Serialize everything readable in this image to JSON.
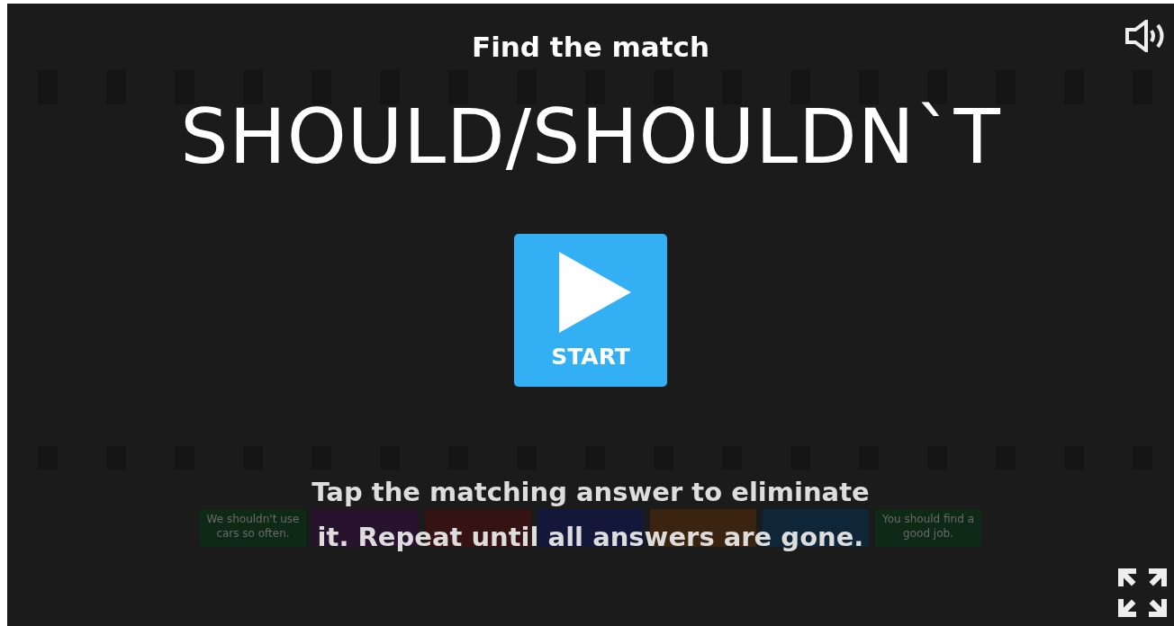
{
  "activity_type": "Find the match",
  "title": "SHOULD/SHOULDN`T",
  "start_button": {
    "label": "START"
  },
  "answer_tiles": [
    {
      "text": "We shouldn't use cars so often.",
      "color": "#0e2a16"
    },
    {
      "color": "#27132d"
    },
    {
      "color": "#361313"
    },
    {
      "color": "#13183a"
    },
    {
      "color": "#3a230f"
    },
    {
      "color": "#0f2638"
    },
    {
      "text": "You should find a good job.",
      "color": "#0e2a16"
    }
  ],
  "instructions": "Tap the matching answer to eliminate it. Repeat until all answers are gone."
}
